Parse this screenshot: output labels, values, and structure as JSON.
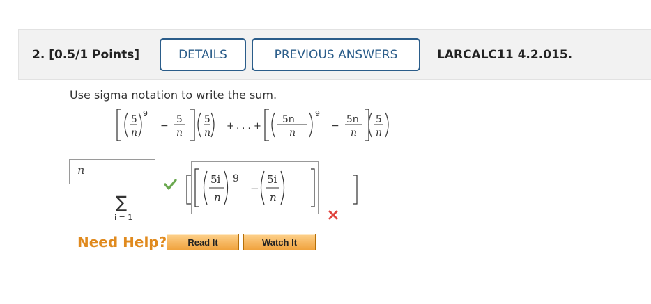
{
  "question": {
    "number": "2.",
    "points": "[0.5/1 Points]",
    "details_label": "DETAILS",
    "previous_answers_label": "PREVIOUS ANSWERS",
    "reference": "LARCALC11 4.2.015."
  },
  "prompt": "Use sigma notation to write the sum.",
  "sum_expression": {
    "num_5": "5",
    "den_n": "n",
    "exp_9": "9",
    "minus": "−",
    "plus": "+",
    "dots": ". . .",
    "num_5n": "5n"
  },
  "answer": {
    "upper_limit_value": "n",
    "sigma": "∑",
    "lower_limit": "i = 1",
    "limit_status": "correct",
    "expression_num": "5i",
    "expression_den": "n",
    "expression_exp": "9",
    "expression_status": "incorrect"
  },
  "help": {
    "need_help_label": "Need Help?",
    "read_it_label": "Read It",
    "watch_it_label": "Watch It"
  },
  "colors": {
    "accent_blue": "#2b5d8a",
    "correct_green": "#6aa84f",
    "incorrect_red": "#e0443e",
    "help_orange": "#e08a1e"
  }
}
